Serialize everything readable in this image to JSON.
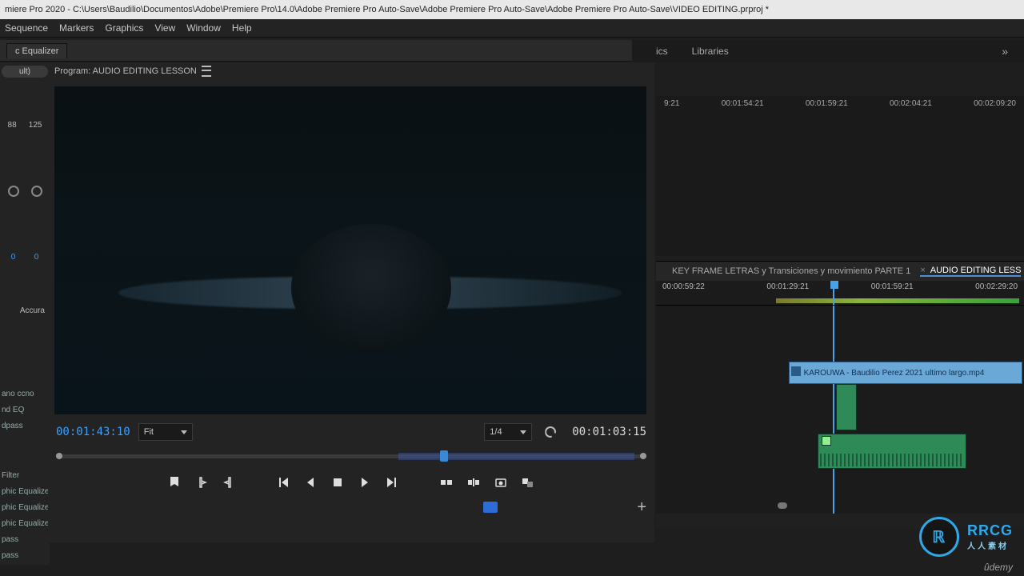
{
  "title_bar": "miere Pro 2020 - C:\\Users\\Baudilio\\Documentos\\Adobe\\Premiere Pro\\14.0\\Adobe Premiere Pro Auto-Save\\Adobe Premiere Pro Auto-Save\\Adobe Premiere Pro Auto-Save\\VIDEO EDITING.prproj *",
  "menu": [
    "Sequence",
    "Markers",
    "Graphics",
    "View",
    "Window",
    "Help"
  ],
  "left_tab": "c Equalizer",
  "right_tabs": {
    "items": [
      "ics",
      "Libraries"
    ],
    "overflow": "»"
  },
  "left_col": {
    "top_nums": [
      "88",
      "125"
    ],
    "zeros": [
      "0",
      "0"
    ],
    "accura": "Accura",
    "filters": [
      "ano ccno",
      "nd EQ",
      "dpass",
      "",
      "Filter",
      "phic Equalize",
      "phic Equalize",
      "phic Equalize",
      "pass",
      "pass"
    ]
  },
  "program": {
    "label": "Program: AUDIO EDITING LESSON",
    "tc_current": "00:01:43:10",
    "fit": "Fit",
    "res": "1/4",
    "tc_end": "00:01:03:15"
  },
  "top_ruler_ticks": [
    "9:21",
    "00:01:54:21",
    "00:01:59:21",
    "00:02:04:21",
    "00:02:09:20"
  ],
  "sequence": {
    "tabs": [
      {
        "label": "KEY FRAME LETRAS y Transiciones y movimiento PARTE 1",
        "active": false,
        "closeable": false
      },
      {
        "label": "AUDIO EDITING LESS",
        "active": true,
        "closeable": true
      }
    ],
    "ruler_ticks": [
      "00:00:59:22",
      "00:01:29:21",
      "00:01:59:21",
      "00:02:29:20"
    ],
    "video_clip": "KAROUWA - Baudilio Perez 2021 ultimo largo.mp4"
  },
  "watermark": {
    "brand": "RRCG",
    "sub": "人人素材",
    "udemy": "ûdemy",
    "logo": "ℝ"
  }
}
